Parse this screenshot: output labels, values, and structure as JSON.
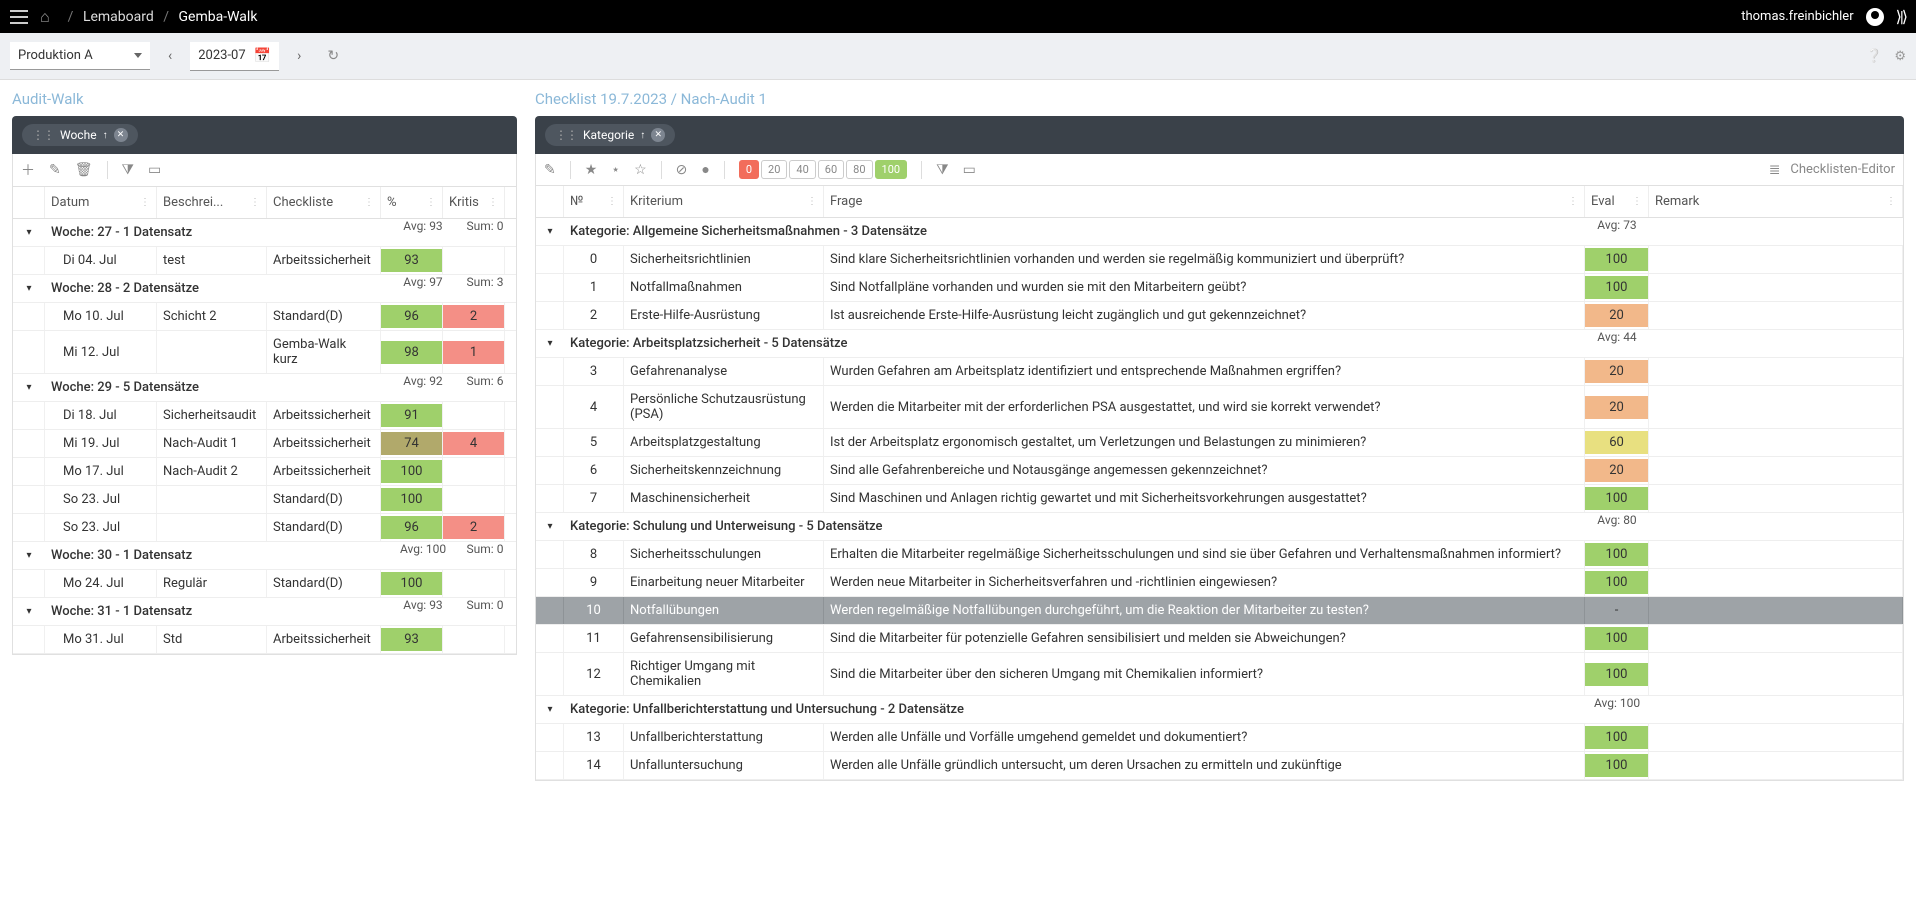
{
  "header": {
    "username": "thomas.freinbichler",
    "crumb1": "Lemaboard",
    "crumb2": "Gemba-Walk"
  },
  "filters": {
    "area": "Produktion A",
    "period": "2023-07"
  },
  "leftPanel": {
    "title": "Audit-Walk",
    "groupChip": "Woche",
    "columns": {
      "datum": "Datum",
      "beschrei": "Beschrei...",
      "checkliste": "Checkliste",
      "pct": "%",
      "kritis": "Kritis"
    },
    "groups": [
      {
        "title": "Woche: 27 - 1 Datensatz",
        "avg": "Avg: 93",
        "sum": "Sum: 0",
        "rows": [
          {
            "datum": "Di 04. Jul",
            "desc": "test",
            "check": "Arbeitssicherheit",
            "pct": "93",
            "pctClass": "bg-green",
            "crit": "",
            "critClass": ""
          }
        ]
      },
      {
        "title": "Woche: 28 - 2 Datensätze",
        "avg": "Avg: 97",
        "sum": "Sum: 3",
        "rows": [
          {
            "datum": "Mo 10. Jul",
            "desc": "Schicht 2",
            "check": "Standard(D)",
            "pct": "96",
            "pctClass": "bg-green",
            "crit": "2",
            "critClass": "bg-red"
          },
          {
            "datum": "Mi 12. Jul",
            "desc": "",
            "check": "Gemba-Walk kurz",
            "pct": "98",
            "pctClass": "bg-green",
            "crit": "1",
            "critClass": "bg-red"
          }
        ]
      },
      {
        "title": "Woche: 29 - 5 Datensätze",
        "avg": "Avg: 92",
        "sum": "Sum: 6",
        "rows": [
          {
            "datum": "Di 18. Jul",
            "desc": "Sicherheitsaudit",
            "check": "Arbeitssicherheit",
            "pct": "91",
            "pctClass": "bg-green",
            "crit": "",
            "critClass": ""
          },
          {
            "datum": "Mi 19. Jul",
            "desc": "Nach-Audit 1",
            "check": "Arbeitssicherheit",
            "pct": "74",
            "pctClass": "bg-olive",
            "crit": "4",
            "critClass": "bg-red",
            "selected": true
          },
          {
            "datum": "Mo 17. Jul",
            "desc": "Nach-Audit 2",
            "check": "Arbeitssicherheit",
            "pct": "100",
            "pctClass": "bg-green",
            "crit": "",
            "critClass": ""
          },
          {
            "datum": "So 23. Jul",
            "desc": "",
            "check": "Standard(D)",
            "pct": "100",
            "pctClass": "bg-green",
            "crit": "",
            "critClass": ""
          },
          {
            "datum": "So 23. Jul",
            "desc": "",
            "check": "Standard(D)",
            "pct": "96",
            "pctClass": "bg-green",
            "crit": "2",
            "critClass": "bg-red"
          }
        ]
      },
      {
        "title": "Woche: 30 - 1 Datensatz",
        "avg": "Avg: 100",
        "sum": "Sum: 0",
        "rows": [
          {
            "datum": "Mo 24. Jul",
            "desc": "Regulär",
            "check": "Standard(D)",
            "pct": "100",
            "pctClass": "bg-green",
            "crit": "",
            "critClass": ""
          }
        ]
      },
      {
        "title": "Woche: 31 - 1 Datensatz",
        "avg": "Avg: 93",
        "sum": "Sum: 0",
        "rows": [
          {
            "datum": "Mo 31. Jul",
            "desc": "Std",
            "check": "Arbeitssicherheit",
            "pct": "93",
            "pctClass": "bg-green",
            "crit": "",
            "critClass": ""
          }
        ]
      }
    ]
  },
  "rightPanel": {
    "title": "Checklist 19.7.2023 / Nach-Audit 1",
    "groupChip": "Kategorie",
    "editorLabel": "Checklisten-Editor",
    "evalChips": [
      "0",
      "20",
      "40",
      "60",
      "80",
      "100"
    ],
    "columns": {
      "no": "№",
      "kriterium": "Kriterium",
      "frage": "Frage",
      "eval": "Eval",
      "remark": "Remark"
    },
    "groups": [
      {
        "title": "Kategorie: Allgemeine Sicherheitsmaßnahmen - 3 Datensätze",
        "avg": "Avg: 73",
        "rows": [
          {
            "no": "0",
            "k": "Sicherheitsrichtlinien",
            "f": "Sind klare Sicherheitsrichtlinien vorhanden und werden sie regelmäßig kommuniziert und überprüft?",
            "eval": "100",
            "ec": "bg-green"
          },
          {
            "no": "1",
            "k": "Notfallmaßnahmen",
            "f": "Sind Notfallpläne vorhanden und wurden sie mit den Mitarbeitern geübt?",
            "eval": "100",
            "ec": "bg-green"
          },
          {
            "no": "2",
            "k": "Erste-Hilfe-Ausrüstung",
            "f": "Ist ausreichende Erste-Hilfe-Ausrüstung leicht zugänglich und gut gekennzeichnet?",
            "eval": "20",
            "ec": "bg-orange"
          }
        ]
      },
      {
        "title": "Kategorie: Arbeitsplatzsicherheit - 5 Datensätze",
        "avg": "Avg: 44",
        "rows": [
          {
            "no": "3",
            "k": "Gefahrenanalyse",
            "f": "Wurden Gefahren am Arbeitsplatz identifiziert und entsprechende Maßnahmen ergriffen?",
            "eval": "20",
            "ec": "bg-orange"
          },
          {
            "no": "4",
            "k": "Persönliche Schutzausrüstung (PSA)",
            "f": "Werden die Mitarbeiter mit der erforderlichen PSA ausgestattet, und wird sie korrekt verwendet?",
            "eval": "20",
            "ec": "bg-orange"
          },
          {
            "no": "5",
            "k": "Arbeitsplatzgestaltung",
            "f": "Ist der Arbeitsplatz ergonomisch gestaltet, um Verletzungen und Belastungen zu minimieren?",
            "eval": "60",
            "ec": "bg-yellow"
          },
          {
            "no": "6",
            "k": "Sicherheitskennzeichnung",
            "f": "Sind alle Gefahrenbereiche und Notausgänge angemessen gekennzeichnet?",
            "eval": "20",
            "ec": "bg-orange"
          },
          {
            "no": "7",
            "k": "Maschinensicherheit",
            "f": "Sind Maschinen und Anlagen richtig gewartet und mit Sicherheitsvorkehrungen ausgestattet?",
            "eval": "100",
            "ec": "bg-green"
          }
        ]
      },
      {
        "title": "Kategorie: Schulung und Unterweisung - 5 Datensätze",
        "avg": "Avg: 80",
        "rows": [
          {
            "no": "8",
            "k": "Sicherheitsschulungen",
            "f": "Erhalten die Mitarbeiter regelmäßige Sicherheitsschulungen und sind sie über Gefahren und Verhaltensmaßnahmen informiert?",
            "eval": "100",
            "ec": "bg-green"
          },
          {
            "no": "9",
            "k": "Einarbeitung neuer Mitarbeiter",
            "f": "Werden neue Mitarbeiter in Sicherheitsverfahren und -richtlinien eingewiesen?",
            "eval": "100",
            "ec": "bg-green"
          },
          {
            "no": "10",
            "k": "Notfallübungen",
            "f": "Werden regelmäßige Notfallübungen durchgeführt, um die Reaktion der Mitarbeiter zu testen?",
            "eval": "-",
            "ec": "",
            "selected": true
          },
          {
            "no": "11",
            "k": "Gefahrensensibilisierung",
            "f": "Sind die Mitarbeiter für potenzielle Gefahren sensibilisiert und melden sie Abweichungen?",
            "eval": "100",
            "ec": "bg-green"
          },
          {
            "no": "12",
            "k": "Richtiger Umgang mit Chemikalien",
            "f": "Sind die Mitarbeiter über den sicheren Umgang mit Chemikalien informiert?",
            "eval": "100",
            "ec": "bg-green"
          }
        ]
      },
      {
        "title": "Kategorie: Unfallberichterstattung und Untersuchung - 2 Datensätze",
        "avg": "Avg: 100",
        "rows": [
          {
            "no": "13",
            "k": "Unfallberichterstattung",
            "f": "Werden alle Unfälle und Vorfälle umgehend gemeldet und dokumentiert?",
            "eval": "100",
            "ec": "bg-green"
          },
          {
            "no": "14",
            "k": "Unfalluntersuchung",
            "f": "Werden alle Unfälle gründlich untersucht, um deren Ursachen zu ermitteln und zukünftige",
            "eval": "100",
            "ec": "bg-green"
          }
        ]
      }
    ]
  }
}
